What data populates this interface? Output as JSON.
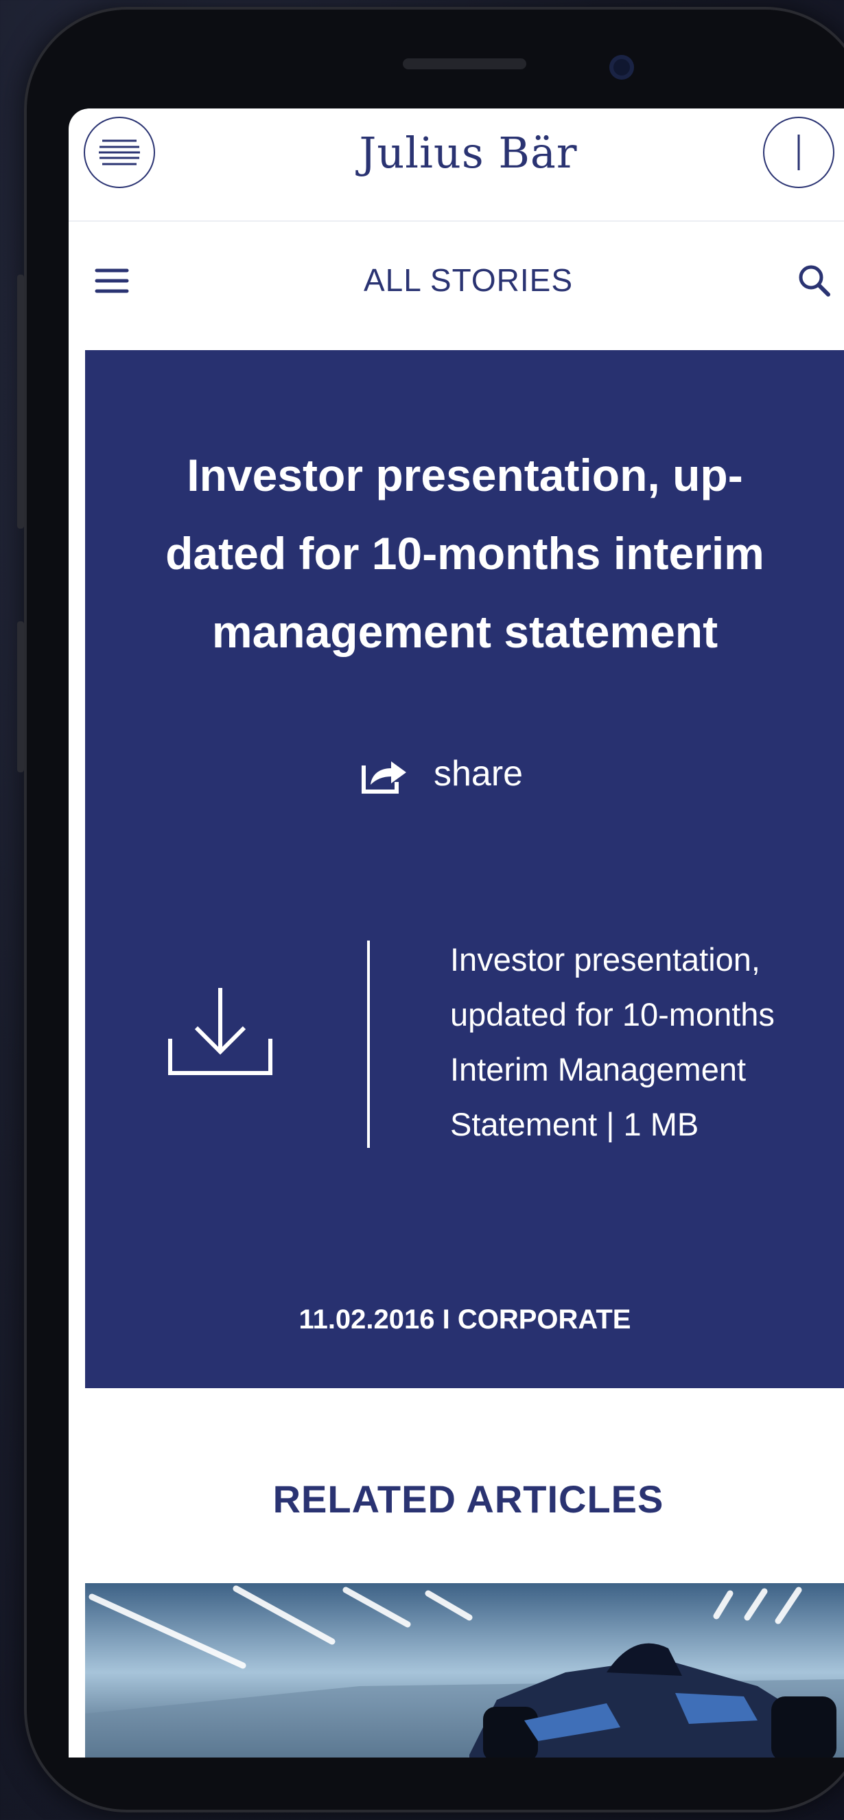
{
  "app": {
    "brand": "Julius Bär"
  },
  "nav": {
    "title": "ALL STORIES"
  },
  "article": {
    "title_lines": [
      "Investor presentation, up-",
      "dated for 10-months interim",
      "management statement"
    ],
    "share_label": "share",
    "download_lines": [
      "Investor presentation,",
      "updated for 10-months",
      "Interim Management",
      "Statement | 1 MB"
    ],
    "meta": "11.02.2016 I CORPORATE"
  },
  "related": {
    "heading": "RELATED ARTICLES"
  },
  "icons": {
    "menu_circle": "menu-lines-icon",
    "info": "info-icon",
    "hamburger": "hamburger-icon",
    "search": "search-icon",
    "share": "share-icon",
    "download": "download-icon"
  },
  "colors": {
    "brand_navy": "#2a3372",
    "card_bg": "#283170",
    "text_on_card": "#ffffff"
  }
}
